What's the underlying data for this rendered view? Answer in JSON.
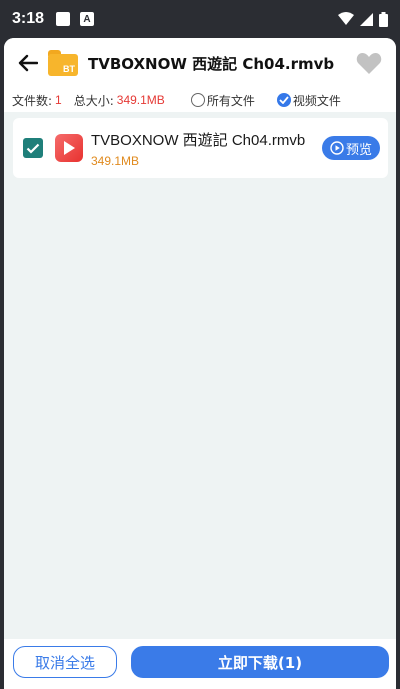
{
  "status_bar": {
    "time": "3:18",
    "icons": [
      "notification-square-icon",
      "a-badge-icon",
      "wifi-icon",
      "signal-icon",
      "battery-icon"
    ]
  },
  "header": {
    "title": "TVBOXNOW 西遊記 Ch04.rmvb",
    "folder_badge": "BT",
    "favorite_active": false
  },
  "info_bar": {
    "file_count_label": "文件数:",
    "file_count_value": "1",
    "total_size_label": "总大小:",
    "total_size_value": "349.1MB",
    "filter_all_label": "所有文件",
    "filter_video_label": "视频文件",
    "selected_filter": "video"
  },
  "files": [
    {
      "name": "TVBOXNOW 西遊記 Ch04.rmvb",
      "size": "349.1MB",
      "checked": true,
      "preview_label": "预览"
    }
  ],
  "bottom_bar": {
    "cancel_all_label": "取消全选",
    "download_label": "立即下载(1)"
  },
  "colors": {
    "accent_blue": "#3a7be8",
    "check_green": "#1f7f7a",
    "size_orange": "#e08a1e",
    "value_red": "#e53935",
    "folder_yellow": "#f7b52c"
  }
}
